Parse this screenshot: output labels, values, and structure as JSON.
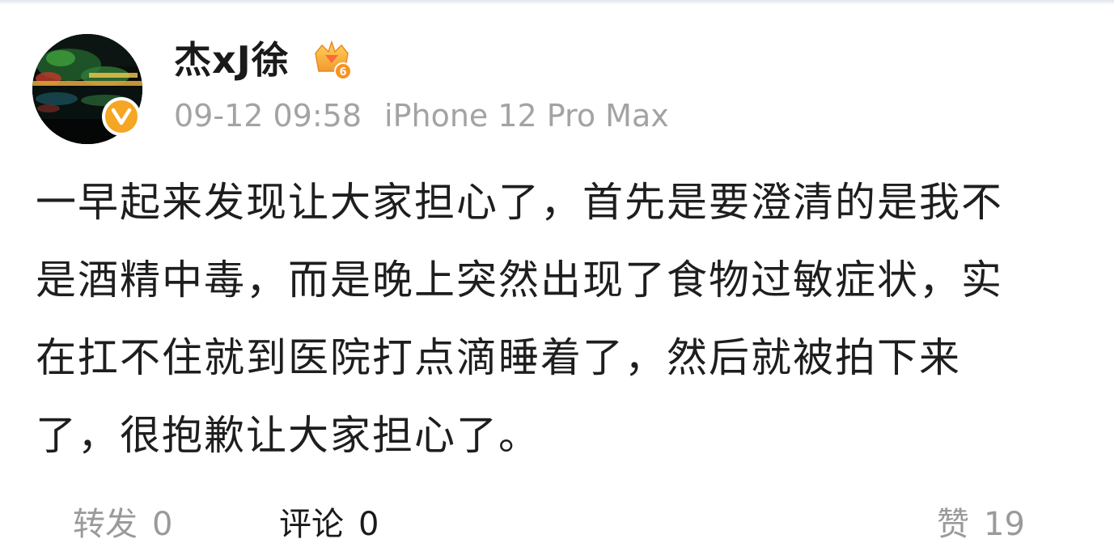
{
  "post": {
    "author": {
      "name": "杰xJ徐",
      "avatar_icon": "avatar-night-lights-image",
      "verified_icon": "verified-v-icon",
      "vip_icon": "vip-crown-level-icon",
      "vip_level": "6",
      "verified_color": "#f5a623"
    },
    "meta": {
      "timestamp": "09-12 09:58",
      "device": "iPhone 12 Pro Max"
    },
    "lines": [
      "一早起来发现让大家担心了，首先是要澄清的是我不",
      "是酒精中毒，而是晚上突然出现了食物过敏症状，实",
      "在扛不住就到医院打点滴睡着了，然后就被拍下来",
      "了，很抱歉让大家担心了。"
    ]
  },
  "actions": {
    "repost": {
      "label": "转发",
      "count": "0"
    },
    "comment": {
      "label": "评论",
      "count": "0"
    },
    "like": {
      "label": "赞",
      "count": "19"
    }
  }
}
